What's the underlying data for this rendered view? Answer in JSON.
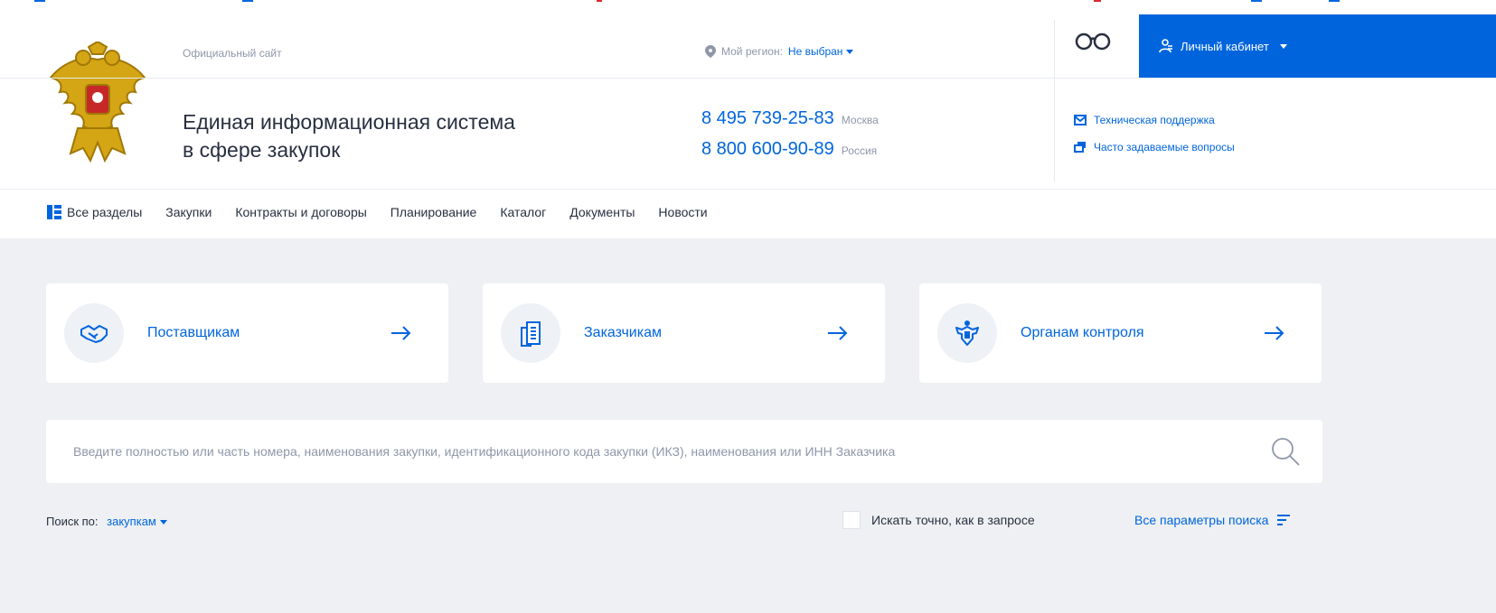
{
  "header": {
    "official_label": "Официальный сайт",
    "title_line1": "Единая информационная система",
    "title_line2": "в сфере закупок",
    "region": {
      "label": "Мой регион:",
      "value": "Не выбран"
    },
    "phones": [
      {
        "number": "8 495 739-25-83",
        "city": "Москва"
      },
      {
        "number": "8 800 600-90-89",
        "city": "Россия"
      }
    ],
    "cabinet_label": "Личный кабинет",
    "support_links": [
      "Техническая поддержка",
      "Часто задаваемые вопросы"
    ]
  },
  "nav": {
    "items": [
      "Все разделы",
      "Закупки",
      "Контракты и договоры",
      "Планирование",
      "Каталог",
      "Документы",
      "Новости"
    ]
  },
  "cards": [
    {
      "label": "Поставщикам",
      "icon": "handshake-icon"
    },
    {
      "label": "Заказчикам",
      "icon": "document-icon"
    },
    {
      "label": "Органам контроля",
      "icon": "emblem-icon"
    }
  ],
  "search": {
    "placeholder": "Введите полностью или часть номера, наименования закупки, идентификационного кода закупки (ИКЗ), наименования или ИНН Заказчика",
    "by_label": "Поиск по:",
    "by_value": "закупкам",
    "exact_label": "Искать точно, как в запросе",
    "all_params_label": "Все параметры поиска"
  },
  "colors": {
    "accent": "#0065dd",
    "text": "#283040",
    "muted": "#8e97a9",
    "main_bg": "#eef0f3"
  }
}
